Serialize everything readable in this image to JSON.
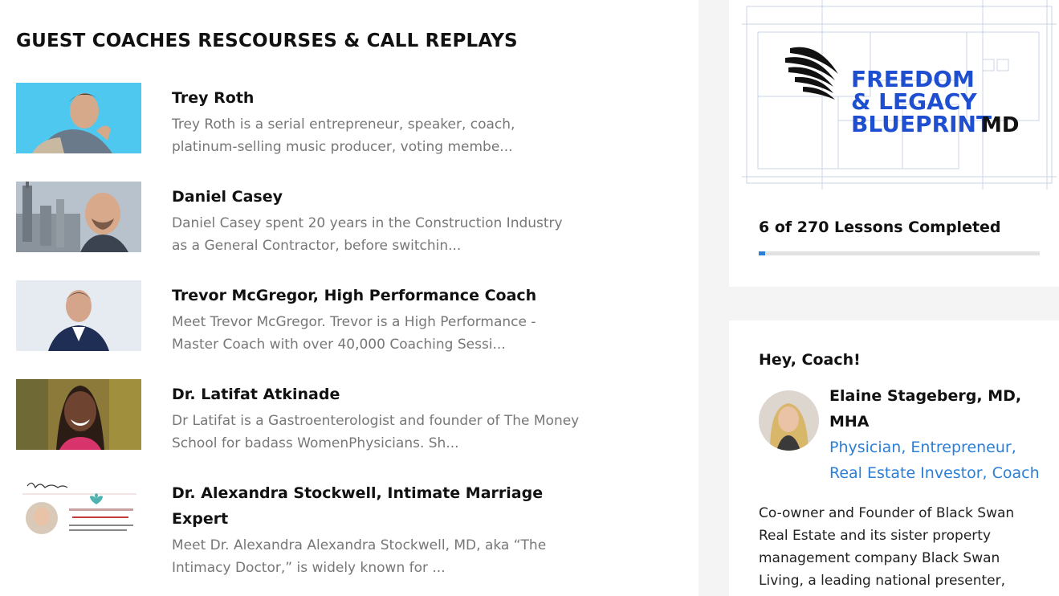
{
  "main": {
    "section_title": "GUEST COACHES RESCOURSES & CALL REPLAYS",
    "coaches": [
      {
        "name": "Trey Roth",
        "description": "Trey Roth is a serial entrepreneur, speaker, coach, platinum-selling music producer, voting membe..."
      },
      {
        "name": "Daniel Casey",
        "description": "Daniel Casey spent 20 years in the Construction Industry as a General Contractor, before switchin..."
      },
      {
        "name": "Trevor McGregor, High Performance Coach",
        "description": "Meet Trevor McGregor. Trevor is a High Performance - Master Coach with over 40,000 Coaching Sessi..."
      },
      {
        "name": "Dr. Latifat Atkinade",
        "description": "Dr Latifat is a Gastroenterologist and founder of The Money School for badass WomenPhysicians. Sh..."
      },
      {
        "name": "Dr. Alexandra Stockwell, Intimate Marriage Expert",
        "description": "Meet Dr. Alexandra Alexandra Stockwell, MD, aka “The Intimacy Doctor,” is widely known for ..."
      }
    ]
  },
  "sidebar": {
    "logo": {
      "line1": "FREEDOM",
      "line2": "& LEGACY",
      "line3": "BLUEPRINT",
      "suffix": "MD"
    },
    "progress": {
      "label": "6 of 270 Lessons Completed",
      "completed": 6,
      "total": 270
    },
    "profile": {
      "greeting": "Hey, Coach!",
      "name": "Elaine Stageberg, MD, MHA",
      "role": "Physician, Entrepreneur, Real Estate Investor, Coach",
      "bio": "Co-owner and Founder of Black Swan Real Estate and its sister property management company Black Swan Living, a leading national presenter, investment thought"
    }
  },
  "colors": {
    "accent": "#2b7fd6",
    "logo_blue": "#1f4fd1",
    "muted_text": "#777777"
  }
}
